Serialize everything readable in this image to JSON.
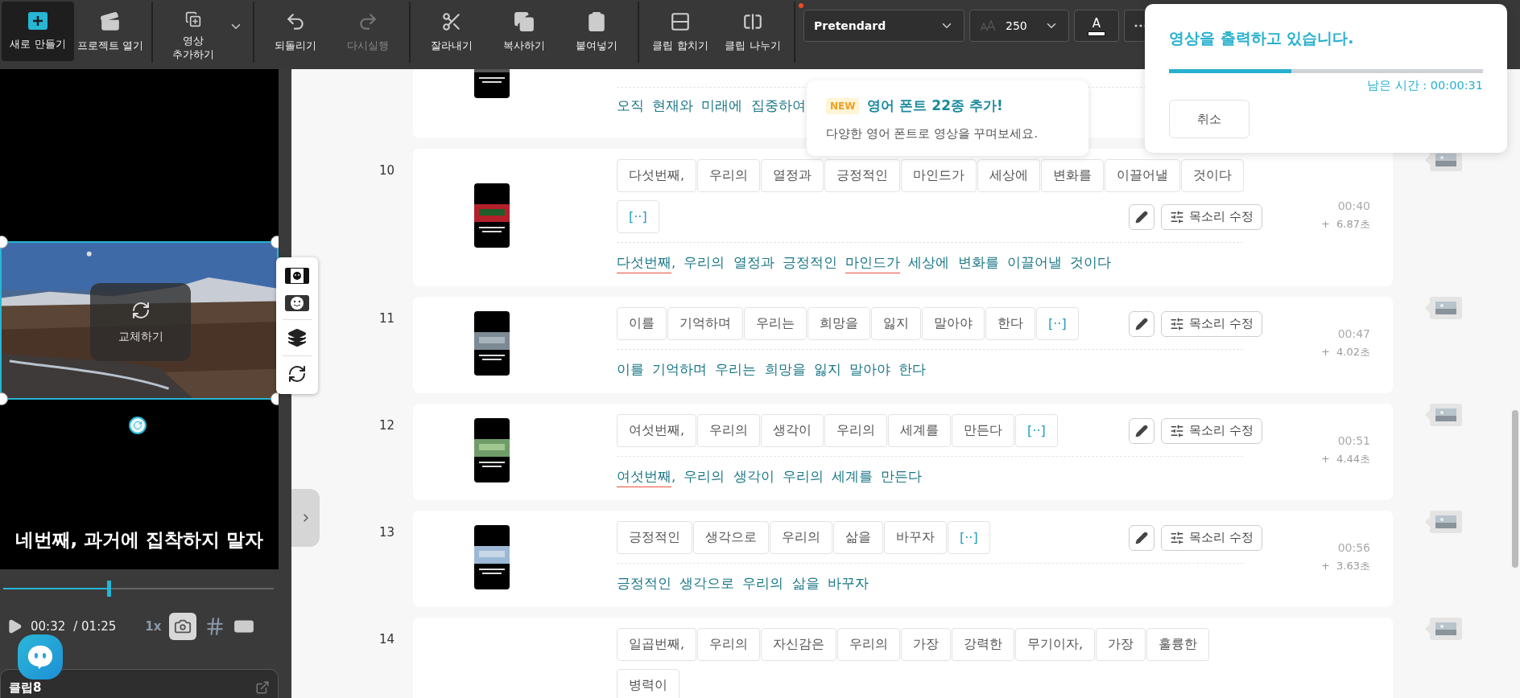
{
  "toolbar": {
    "groups": [
      [
        {
          "label": "새로 만들기",
          "kind": "button",
          "selected": true,
          "disabled": false
        },
        {
          "label": "프로젝트 열기",
          "kind": "button",
          "selected": false,
          "disabled": false
        }
      ],
      [
        {
          "label": "영상 추가하기",
          "kind": "dropdown",
          "selected": false,
          "disabled": false
        }
      ],
      [
        {
          "label": "되돌리기",
          "kind": "button",
          "selected": false,
          "disabled": false
        },
        {
          "label": "다시실행",
          "kind": "button",
          "selected": false,
          "disabled": true
        }
      ],
      [
        {
          "label": "잘라내기",
          "kind": "button",
          "selected": false,
          "disabled": false
        },
        {
          "label": "복사하기",
          "kind": "button",
          "selected": false,
          "disabled": false
        },
        {
          "label": "붙여넣기",
          "kind": "button",
          "selected": false,
          "disabled": false
        }
      ],
      [
        {
          "label": "클립 합치기",
          "kind": "button",
          "selected": false,
          "disabled": false
        },
        {
          "label": "클립 나누기",
          "kind": "button",
          "selected": false,
          "disabled": false
        }
      ]
    ],
    "notice": true,
    "font": "Pretendard",
    "size": "250",
    "color_label": "A"
  },
  "tooltip": {
    "badge": "NEW",
    "title": "영어 폰트 22종 추가!",
    "text": "다양한 영어 폰트로 영상을 꾸며보세요."
  },
  "export": {
    "title": "영상을 출력하고 있습니다.",
    "level": 0.39,
    "remaining": "남은 시간 : 00:00:31",
    "cancel": "취소"
  },
  "preview": {
    "replace_label": "교체하기",
    "subtitle": "네번째, 과거에 집착하지 말자",
    "level": 0.39,
    "current": "00:32",
    "total": "/ 01:25",
    "speed": "1x",
    "clip_title": "클립8"
  },
  "rows": [
    {
      "kind": "tail",
      "sentence": [
        {
          "text": "오직 현재와 미래에 집중하여",
          "flagged": false
        }
      ]
    },
    {
      "kind": "full",
      "number": "10",
      "chips": [
        {
          "text": "다섯번째,",
          "kind": "word"
        },
        {
          "text": "우리의",
          "kind": "word"
        },
        {
          "text": "열정과",
          "kind": "word"
        },
        {
          "text": "긍정적인",
          "kind": "word"
        },
        {
          "text": "마인드가",
          "kind": "word"
        },
        {
          "text": "세상에",
          "kind": "word"
        },
        {
          "text": "변화를",
          "kind": "word"
        },
        {
          "text": "이끌어낼",
          "kind": "word"
        },
        {
          "text": "것이다",
          "kind": "word"
        },
        {
          "text": "[··]",
          "kind": "pause"
        }
      ],
      "voice": "목소리 수정",
      "time": "00:40",
      "duration": "+  6.87초",
      "sentence": [
        {
          "text": "다섯번째",
          "flagged": true
        },
        {
          "text": ", 우리의 열정과 긍정적인 ",
          "flagged": false
        },
        {
          "text": "마인드가",
          "flagged": true
        },
        {
          "text": " 세상에 변화를 이끌어낼 것이다",
          "flagged": false
        }
      ]
    },
    {
      "kind": "full",
      "number": "11",
      "chips": [
        {
          "text": "이를",
          "kind": "word"
        },
        {
          "text": "기억하며",
          "kind": "word"
        },
        {
          "text": "우리는",
          "kind": "word"
        },
        {
          "text": "희망을",
          "kind": "word"
        },
        {
          "text": "잃지",
          "kind": "word"
        },
        {
          "text": "말아야",
          "kind": "word"
        },
        {
          "text": "한다",
          "kind": "word"
        },
        {
          "text": "[··]",
          "kind": "pause"
        }
      ],
      "voice": "목소리 수정",
      "time": "00:47",
      "duration": "+  4.02초",
      "sentence": [
        {
          "text": "이를 기억하며 우리는 희망을 잃지 말아야 한다",
          "flagged": false
        }
      ]
    },
    {
      "kind": "full",
      "number": "12",
      "chips": [
        {
          "text": "여섯번째,",
          "kind": "word"
        },
        {
          "text": "우리의",
          "kind": "word"
        },
        {
          "text": "생각이",
          "kind": "word"
        },
        {
          "text": "우리의",
          "kind": "word"
        },
        {
          "text": "세계를",
          "kind": "word"
        },
        {
          "text": "만든다",
          "kind": "word"
        },
        {
          "text": "[··]",
          "kind": "pause"
        }
      ],
      "voice": "목소리 수정",
      "time": "00:51",
      "duration": "+  4.44초",
      "sentence": [
        {
          "text": "여섯번째",
          "flagged": true
        },
        {
          "text": ", 우리의 생각이 우리의 세계를 만든다",
          "flagged": false
        }
      ]
    },
    {
      "kind": "full",
      "number": "13",
      "chips": [
        {
          "text": "긍정적인",
          "kind": "word"
        },
        {
          "text": "생각으로",
          "kind": "word"
        },
        {
          "text": "우리의",
          "kind": "word"
        },
        {
          "text": "삶을",
          "kind": "word"
        },
        {
          "text": "바꾸자",
          "kind": "word"
        },
        {
          "text": "[··]",
          "kind": "pause"
        }
      ],
      "voice": "목소리 수정",
      "time": "00:56",
      "duration": "+  3.63초",
      "sentence": [
        {
          "text": "긍정적인 생각으로 우리의 삶을 바꾸자",
          "flagged": false
        }
      ]
    },
    {
      "kind": "head",
      "number": "14",
      "chips": [
        {
          "text": "일곱번째,",
          "kind": "word"
        },
        {
          "text": "우리의",
          "kind": "word"
        },
        {
          "text": "자신감은",
          "kind": "word"
        },
        {
          "text": "우리의",
          "kind": "word"
        },
        {
          "text": "가장",
          "kind": "word"
        },
        {
          "text": "강력한",
          "kind": "word"
        },
        {
          "text": "무기이자,",
          "kind": "word"
        },
        {
          "text": "가장",
          "kind": "word"
        },
        {
          "text": "훌륭한",
          "kind": "word"
        },
        {
          "text": "병력이",
          "kind": "word"
        }
      ]
    }
  ]
}
